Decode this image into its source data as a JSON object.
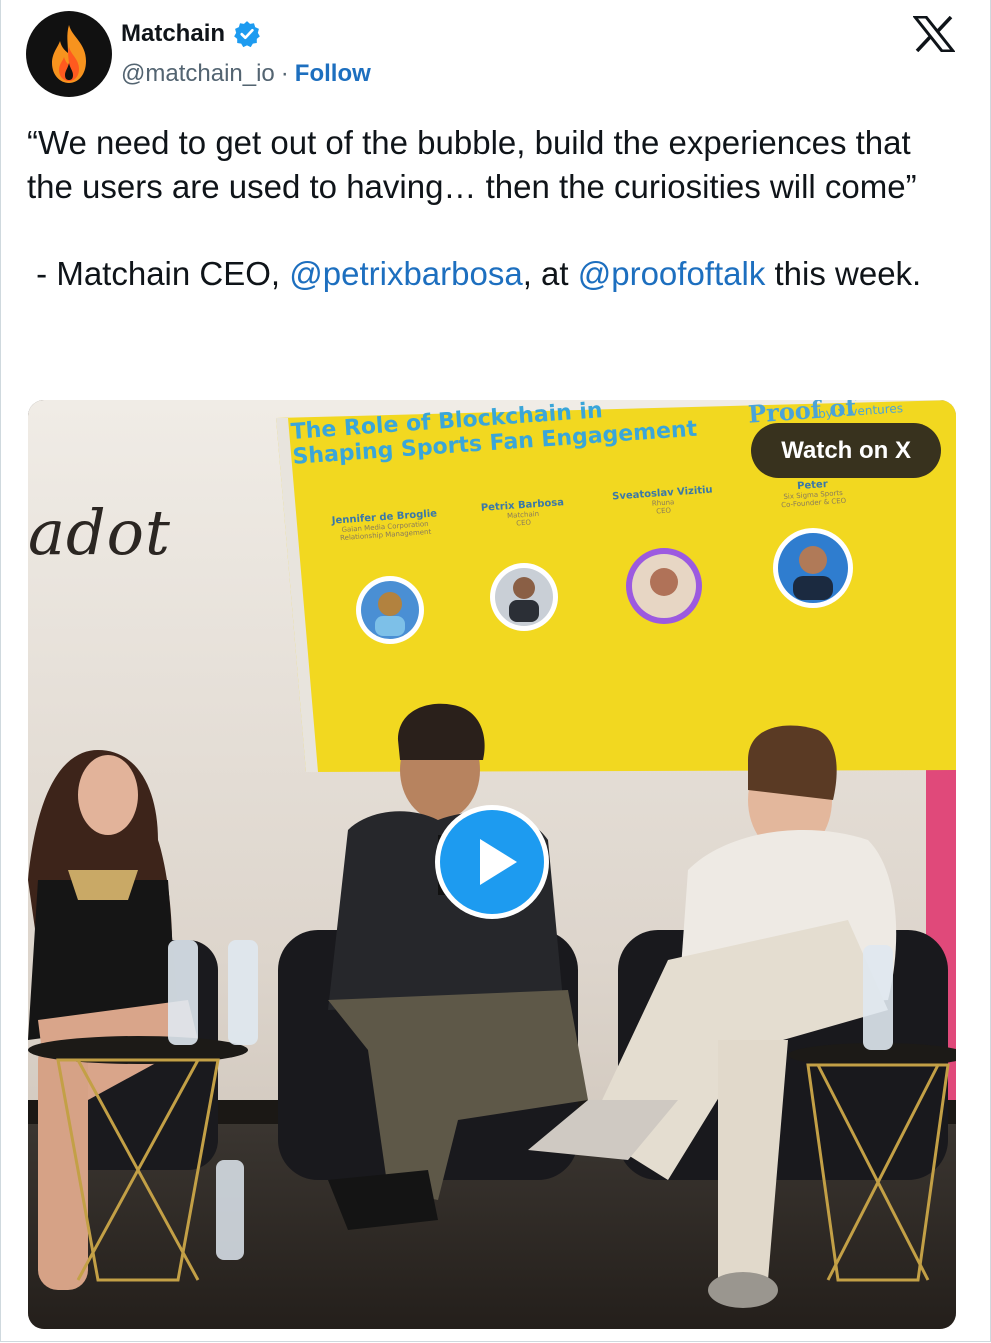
{
  "author": {
    "name": "Matchain",
    "handle": "@matchain_io",
    "separator": "·",
    "follow_label": "Follow",
    "verified": true,
    "avatar_icon": "flame-icon"
  },
  "platform_icon": "x-logo-icon",
  "tweet": {
    "quote": "“We need to get out of the bubble, build the experiences that the users are used to having… then the curiosities will come”",
    "attribution_prefix": " - Matchain CEO, ",
    "mention_1": "@petrixbarbosa",
    "attribution_middle": ", at ",
    "mention_2": "@proofoftalk",
    "attribution_suffix": " this week."
  },
  "media": {
    "watch_label": "Watch on X",
    "play_icon": "play-icon",
    "slide": {
      "title_line1": "The Role of Blockchain in",
      "title_line2": "Shaping Sports Fan Engagement",
      "logo_text": "Proof of",
      "logo_sub": "by ✕ ventures",
      "speakers": [
        {
          "name": "Jennifer de Broglie",
          "org": "Gaian Media Corporation",
          "role": "Relationship Management"
        },
        {
          "name": "Petrix Barbosa",
          "org": "Matchain",
          "role": "CEO"
        },
        {
          "name": "Sveatoslav Vizitiu",
          "org": "Rhuna",
          "role": "CEO"
        },
        {
          "name": "Peter",
          "org": "Six Sigma Sports",
          "role": "Co-Founder & CEO"
        }
      ]
    },
    "backdrop_text": "adot"
  },
  "colors": {
    "link": "#1d6fbf",
    "verified": "#1d9bf0",
    "slide_yellow": "#f2d820",
    "play_blue": "#1d9bf0"
  }
}
